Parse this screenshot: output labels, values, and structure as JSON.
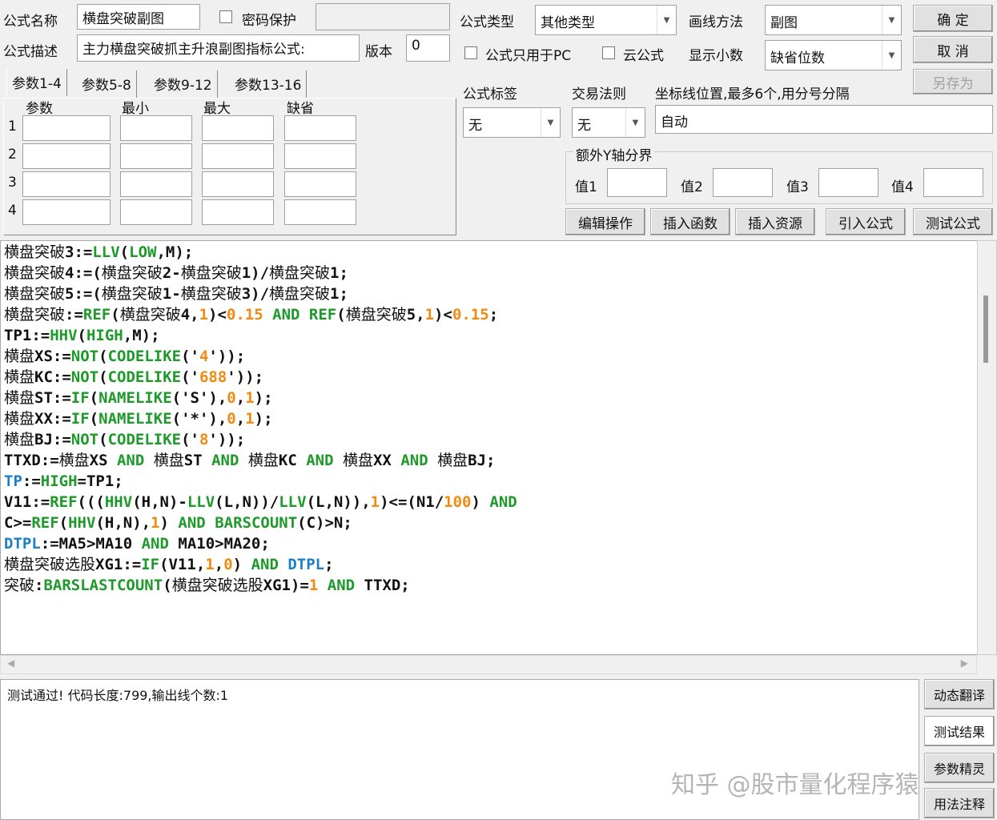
{
  "header": {
    "name_label": "公式名称",
    "name_value": "横盘突破副图",
    "password_label": "密码保护",
    "desc_label": "公式描述",
    "desc_value": "主力横盘突破抓主升浪副图指标公式:",
    "version_label": "版本",
    "version_value": "0",
    "type_label": "公式类型",
    "type_value": "其他类型",
    "draw_label": "画线方法",
    "draw_value": "副图",
    "pc_only_label": "公式只用于PC",
    "cloud_label": "云公式",
    "decimals_label": "显示小数",
    "decimals_value": "缺省位数",
    "tag_label": "公式标签",
    "tag_value": "无",
    "trade_label": "交易法则",
    "trade_value": "无",
    "axis_label": "坐标线位置,最多6个,用分号分隔",
    "axis_value": "自动",
    "yaxis_group": "额外Y轴分界",
    "y_labels": [
      "值1",
      "值2",
      "值3",
      "值4"
    ]
  },
  "buttons": {
    "ok": "确 定",
    "cancel": "取 消",
    "save_as": "另存为",
    "edit": "编辑操作",
    "insert_func": "插入函数",
    "insert_res": "插入资源",
    "import": "引入公式",
    "test": "测试公式",
    "translate": "动态翻译",
    "test_result": "测试结果",
    "param_wizard": "参数精灵",
    "usage": "用法注释"
  },
  "params": {
    "tabs": [
      "参数1-4",
      "参数5-8",
      "参数9-12",
      "参数13-16"
    ],
    "columns": [
      "参数",
      "最小",
      "最大",
      "缺省"
    ],
    "rows": [
      "1",
      "2",
      "3",
      "4"
    ]
  },
  "code": [
    [
      [
        "横盘突破",
        "Kz"
      ],
      [
        "3:=",
        "K"
      ],
      [
        "LLV",
        "G"
      ],
      [
        "(",
        "K"
      ],
      [
        "LOW",
        "G"
      ],
      [
        ",M);",
        "K"
      ]
    ],
    [
      [
        "横盘突破",
        "Kz"
      ],
      [
        "4:=(",
        "K"
      ],
      [
        "横盘突破",
        "Kz"
      ],
      [
        "2-",
        "K"
      ],
      [
        "横盘突破",
        "Kz"
      ],
      [
        "1)/",
        "K"
      ],
      [
        "横盘突破",
        "Kz"
      ],
      [
        "1;",
        "K"
      ]
    ],
    [
      [
        "横盘突破",
        "Kz"
      ],
      [
        "5:=(",
        "K"
      ],
      [
        "横盘突破",
        "Kz"
      ],
      [
        "1-",
        "K"
      ],
      [
        "横盘突破",
        "Kz"
      ],
      [
        "3)/",
        "K"
      ],
      [
        "横盘突破",
        "Kz"
      ],
      [
        "1;",
        "K"
      ]
    ],
    [
      [
        "横盘突破",
        "Kz"
      ],
      [
        ":=",
        "K"
      ],
      [
        "REF",
        "G"
      ],
      [
        "(",
        "K"
      ],
      [
        "横盘突破",
        "Kz"
      ],
      [
        "4,",
        "K"
      ],
      [
        "1",
        "O"
      ],
      [
        ")<",
        "K"
      ],
      [
        "0.15",
        "O"
      ],
      [
        " AND ",
        "G"
      ],
      [
        "REF",
        "G"
      ],
      [
        "(",
        "K"
      ],
      [
        "横盘突破",
        "Kz"
      ],
      [
        "5,",
        "K"
      ],
      [
        "1",
        "O"
      ],
      [
        ")<",
        "K"
      ],
      [
        "0.15",
        "O"
      ],
      [
        ";",
        "K"
      ]
    ],
    [
      [
        "TP1:=",
        "K"
      ],
      [
        "HHV",
        "G"
      ],
      [
        "(",
        "K"
      ],
      [
        "HIGH",
        "G"
      ],
      [
        ",M);",
        "K"
      ]
    ],
    [
      [
        "横盘",
        "Kz"
      ],
      [
        "XS:=",
        "K"
      ],
      [
        "NOT",
        "G"
      ],
      [
        "(",
        "K"
      ],
      [
        "CODELIKE",
        "G"
      ],
      [
        "('",
        "K"
      ],
      [
        "4",
        "O"
      ],
      [
        "'));",
        "K"
      ]
    ],
    [
      [
        "横盘",
        "Kz"
      ],
      [
        "KC:=",
        "K"
      ],
      [
        "NOT",
        "G"
      ],
      [
        "(",
        "K"
      ],
      [
        "CODELIKE",
        "G"
      ],
      [
        "('",
        "K"
      ],
      [
        "688",
        "O"
      ],
      [
        "'));",
        "K"
      ]
    ],
    [
      [
        "横盘",
        "Kz"
      ],
      [
        "ST:=",
        "K"
      ],
      [
        "IF",
        "G"
      ],
      [
        "(",
        "K"
      ],
      [
        "NAMELIKE",
        "G"
      ],
      [
        "('S'),",
        "K"
      ],
      [
        "0",
        "O"
      ],
      [
        ",",
        "K"
      ],
      [
        "1",
        "O"
      ],
      [
        ");",
        "K"
      ]
    ],
    [
      [
        "横盘",
        "Kz"
      ],
      [
        "XX:=",
        "K"
      ],
      [
        "IF",
        "G"
      ],
      [
        "(",
        "K"
      ],
      [
        "NAMELIKE",
        "G"
      ],
      [
        "('*'),",
        "K"
      ],
      [
        "0",
        "O"
      ],
      [
        ",",
        "K"
      ],
      [
        "1",
        "O"
      ],
      [
        ");",
        "K"
      ]
    ],
    [
      [
        "横盘",
        "Kz"
      ],
      [
        "BJ:=",
        "K"
      ],
      [
        "NOT",
        "G"
      ],
      [
        "(",
        "K"
      ],
      [
        "CODELIKE",
        "G"
      ],
      [
        "('",
        "K"
      ],
      [
        "8",
        "O"
      ],
      [
        "'));",
        "K"
      ]
    ],
    [
      [
        "TTXD:=",
        "K"
      ],
      [
        "横盘",
        "Kz"
      ],
      [
        "XS",
        "K"
      ],
      [
        " AND ",
        "G"
      ],
      [
        "横盘",
        "Kz"
      ],
      [
        "ST",
        "K"
      ],
      [
        " AND ",
        "G"
      ],
      [
        "横盘",
        "Kz"
      ],
      [
        "KC",
        "K"
      ],
      [
        " AND ",
        "G"
      ],
      [
        "横盘",
        "Kz"
      ],
      [
        "XX",
        "K"
      ],
      [
        " AND ",
        "G"
      ],
      [
        "横盘",
        "Kz"
      ],
      [
        "BJ;",
        "K"
      ]
    ],
    [
      [
        "TP",
        "B"
      ],
      [
        ":=",
        "K"
      ],
      [
        "HIGH",
        "G"
      ],
      [
        "=TP1;",
        "K"
      ]
    ],
    [
      [
        "V11:=",
        "K"
      ],
      [
        "REF",
        "G"
      ],
      [
        "(((",
        "K"
      ],
      [
        "HHV",
        "G"
      ],
      [
        "(H,N)-",
        "K"
      ],
      [
        "LLV",
        "G"
      ],
      [
        "(L,N))/",
        "K"
      ],
      [
        "LLV",
        "G"
      ],
      [
        "(L,N)),",
        "K"
      ],
      [
        "1",
        "O"
      ],
      [
        ")<=(N1/",
        "K"
      ],
      [
        "100",
        "O"
      ],
      [
        ") ",
        "K"
      ],
      [
        "AND",
        "G"
      ]
    ],
    [
      [
        "C>=",
        "K"
      ],
      [
        "REF",
        "G"
      ],
      [
        "(",
        "K"
      ],
      [
        "HHV",
        "G"
      ],
      [
        "(H,N),",
        "K"
      ],
      [
        "1",
        "O"
      ],
      [
        ") ",
        "K"
      ],
      [
        "AND",
        "G"
      ],
      [
        " ",
        "K"
      ],
      [
        "BARSCOUNT",
        "G"
      ],
      [
        "(C)>N;",
        "K"
      ]
    ],
    [
      [
        "DTPL",
        "B"
      ],
      [
        ":=MA5>MA10 ",
        "K"
      ],
      [
        "AND",
        "G"
      ],
      [
        " MA10>MA20;",
        "K"
      ]
    ],
    [
      [
        "横盘突破选股",
        "Kz"
      ],
      [
        "XG1:=",
        "K"
      ],
      [
        "IF",
        "G"
      ],
      [
        "(V11,",
        "K"
      ],
      [
        "1",
        "O"
      ],
      [
        ",",
        "K"
      ],
      [
        "0",
        "O"
      ],
      [
        ") ",
        "K"
      ],
      [
        "AND",
        "G"
      ],
      [
        " ",
        "K"
      ],
      [
        "DTPL",
        "B"
      ],
      [
        ";",
        "K"
      ]
    ],
    [
      [
        "突破",
        "Kz"
      ],
      [
        ":",
        "K"
      ],
      [
        "BARSLASTCOUNT",
        "G"
      ],
      [
        "(",
        "K"
      ],
      [
        "横盘突破选股",
        "Kz"
      ],
      [
        "XG1)=",
        "K"
      ],
      [
        "1",
        "O"
      ],
      [
        " AND ",
        "G"
      ],
      [
        "TTXD;",
        "K"
      ]
    ]
  ],
  "output": {
    "message": "测试通过! 代码长度:799,输出线个数:1"
  },
  "watermark": "知乎 @股市量化程序猿"
}
